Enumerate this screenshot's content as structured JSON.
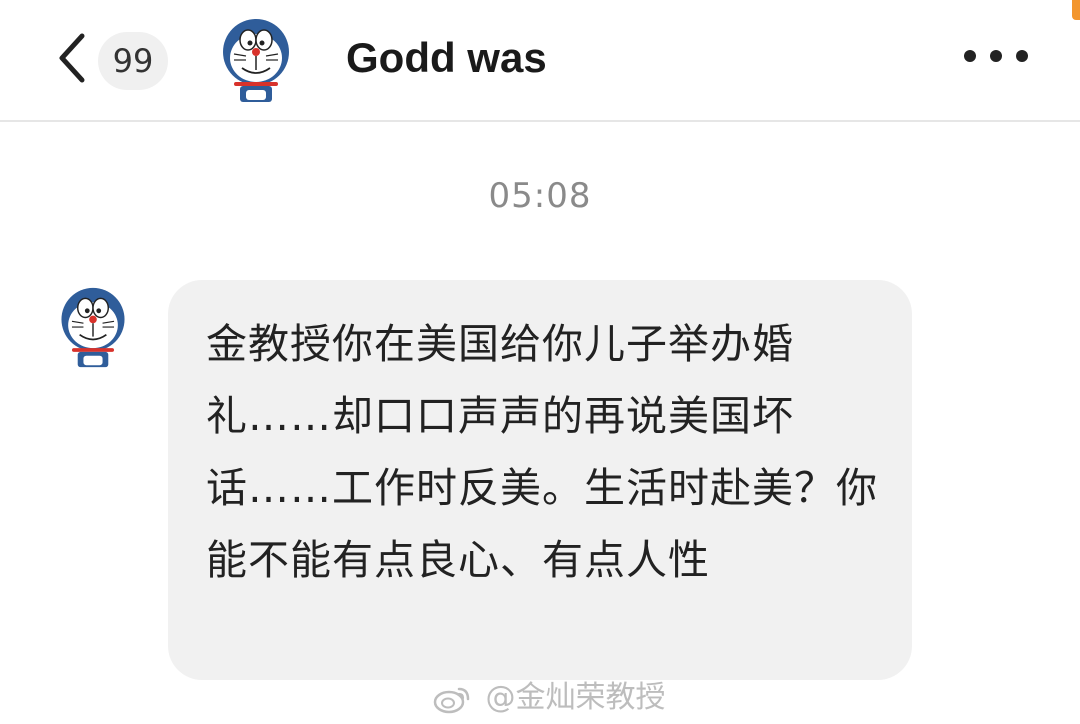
{
  "header": {
    "back_count": "99",
    "title": "Godd was"
  },
  "timestamp": "05:08",
  "message": {
    "text": "金教授你在美国给你儿子举办婚礼……却口口声声的再说美国坏话……工作时反美。生活时赴美？你能不能有点良心、有点人性"
  },
  "watermark": "@金灿荣教授",
  "icons": {
    "back": "chevron-left-icon",
    "more": "more-dots-icon",
    "avatar": "doraemon-avatar-icon",
    "weibo": "weibo-logo-icon"
  },
  "colors": {
    "bubble": "#f1f1f1",
    "timestamp": "#8a8a8a",
    "accent_orange": "#f3962d"
  }
}
